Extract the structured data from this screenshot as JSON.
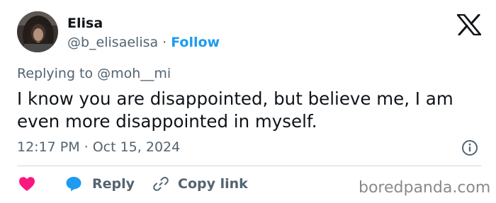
{
  "tweet": {
    "author": {
      "display_name": "Elisa",
      "handle": "@b_elisaelisa",
      "separator": "·",
      "follow_label": "Follow"
    },
    "replying_prefix": "Replying to",
    "replying_to": "@moh__mi",
    "text": "I know you are disappointed, but believe me, I am even more disappointed in myself.",
    "time": "12:17 PM",
    "date_separator": "·",
    "date": "Oct 15, 2024"
  },
  "actions": {
    "reply_label": "Reply",
    "copy_link_label": "Copy link"
  },
  "watermark": "boredpanda.com",
  "icons": {
    "platform": "x-logo-icon",
    "info": "info-icon",
    "like": "heart-icon",
    "reply": "speech-bubble-icon",
    "copy_link": "link-icon"
  },
  "colors": {
    "accent": "#1d9bf0",
    "like": "#f91880",
    "text_primary": "#0f1419",
    "text_secondary": "#536471",
    "divider": "#cfd9de",
    "watermark": "#8a8a8a"
  }
}
